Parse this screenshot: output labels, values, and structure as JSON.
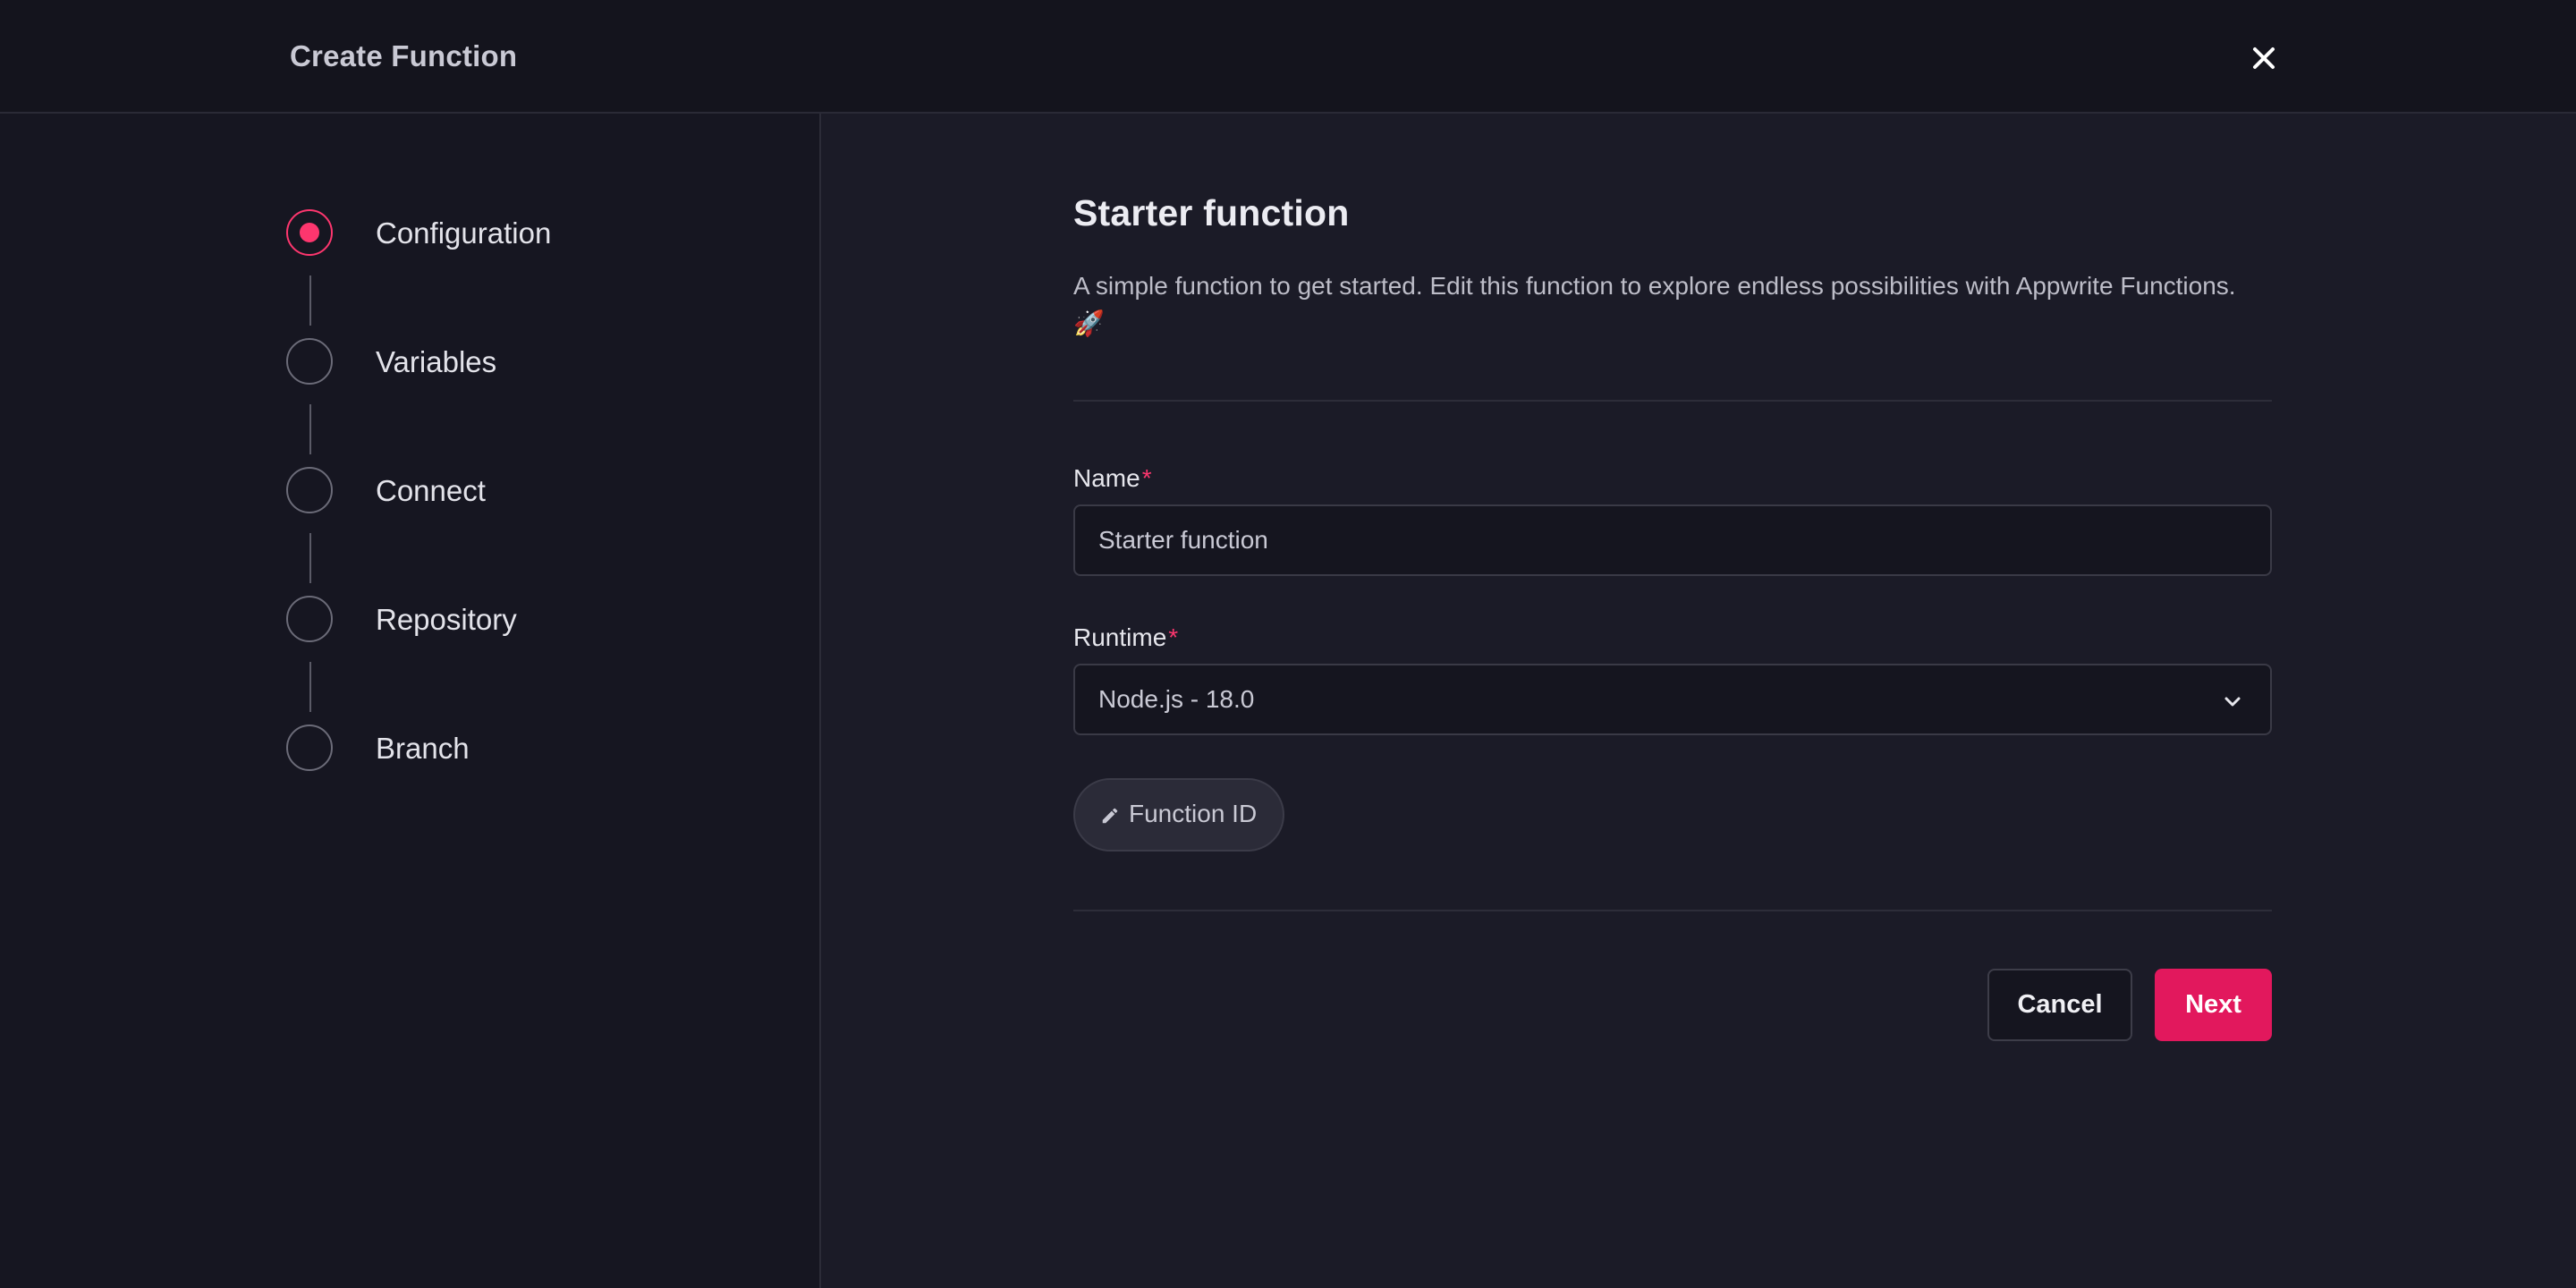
{
  "header": {
    "title": "Create Function",
    "close_icon": "close-icon"
  },
  "steps": [
    {
      "label": "Configuration",
      "state": "active"
    },
    {
      "label": "Variables",
      "state": "pending"
    },
    {
      "label": "Connect",
      "state": "pending"
    },
    {
      "label": "Repository",
      "state": "pending"
    },
    {
      "label": "Branch",
      "state": "pending"
    }
  ],
  "main": {
    "title": "Starter function",
    "description": "A simple function to get started. Edit this function to explore endless possibilities with Appwrite Functions. 🚀",
    "name_field": {
      "label": "Name",
      "required_mark": "*",
      "value": "Starter function"
    },
    "runtime_field": {
      "label": "Runtime",
      "required_mark": "*",
      "value": "Node.js - 18.0",
      "icon": "chevron-down-icon"
    },
    "function_id_button": {
      "label": "Function ID",
      "icon": "pencil-icon"
    },
    "actions": {
      "cancel_label": "Cancel",
      "next_label": "Next"
    }
  },
  "colors": {
    "accent": "#fd366e",
    "primary_button": "#e2185d",
    "background": "#1b1b27",
    "sidebar": "#161621",
    "topbar": "#14141d"
  }
}
